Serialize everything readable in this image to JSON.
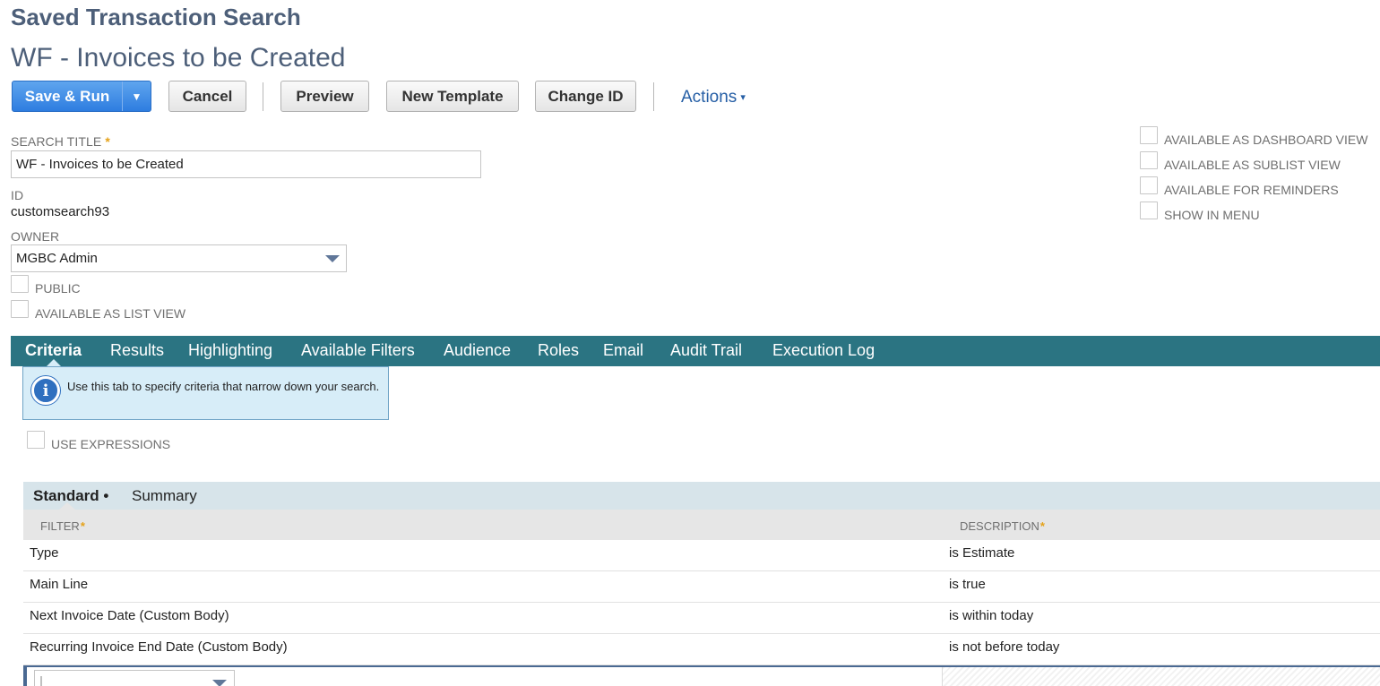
{
  "page": {
    "type_title": "Saved Transaction Search",
    "search_name": "WF - Invoices to be Created"
  },
  "toolbar": {
    "save_run": "Save & Run",
    "save_run_menu_icon": "▼",
    "cancel": "Cancel",
    "preview": "Preview",
    "new_template": "New Template",
    "change_id": "Change ID",
    "actions": "Actions",
    "actions_caret": "▾"
  },
  "fields": {
    "search_title_label": "SEARCH TITLE",
    "required_mark": "*",
    "search_title_value": "WF - Invoices to be Created",
    "id_label": "ID",
    "id_value": "customsearch93",
    "owner_label": "OWNER",
    "owner_value": "MGBC Admin",
    "public_label": "PUBLIC",
    "public_checked": false,
    "list_view_label": "AVAILABLE AS LIST VIEW",
    "list_view_checked": false
  },
  "options": [
    {
      "label": "AVAILABLE AS DASHBOARD VIEW",
      "checked": false
    },
    {
      "label": "AVAILABLE AS SUBLIST VIEW",
      "checked": false
    },
    {
      "label": "AVAILABLE FOR REMINDERS",
      "checked": false
    },
    {
      "label": "SHOW IN MENU",
      "checked": false
    }
  ],
  "tabs": [
    {
      "label": "Criteria",
      "active": true
    },
    {
      "label": "Results"
    },
    {
      "label": "Highlighting"
    },
    {
      "label": "Available Filters"
    },
    {
      "label": "Audience"
    },
    {
      "label": "Roles"
    },
    {
      "label": "Email"
    },
    {
      "label": "Audit Trail"
    },
    {
      "label": "Execution Log"
    }
  ],
  "info": {
    "icon": "i",
    "text": "Use this tab to specify criteria that narrow down your search."
  },
  "use_expressions": {
    "label": "USE EXPRESSIONS",
    "checked": false
  },
  "subtabs": [
    {
      "label": "Standard •",
      "active": true
    },
    {
      "label": "Summary"
    }
  ],
  "criteria_table": {
    "columns": [
      "FILTER",
      "DESCRIPTION"
    ],
    "rows": [
      {
        "filter": "Type",
        "description": "is Estimate"
      },
      {
        "filter": "Main Line",
        "description": "is true"
      },
      {
        "filter": "Next Invoice Date (Custom Body)",
        "description": "is within today"
      },
      {
        "filter": "Recurring Invoice End Date (Custom Body)",
        "description": "is not before today"
      }
    ]
  },
  "colors": {
    "accent_blue": "#2e7de0",
    "tab_bar": "#2b7482",
    "title_text": "#4d5f79",
    "required": "#e5a21a",
    "info_bg": "#d7edf8"
  }
}
